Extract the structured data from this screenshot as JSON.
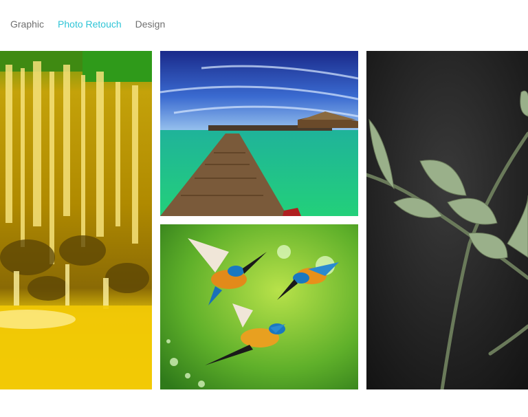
{
  "filter_tabs": [
    {
      "label": "Graphic",
      "active": false
    },
    {
      "label": "Photo Retouch",
      "active": true
    },
    {
      "label": "Design",
      "active": false
    }
  ],
  "accent_color": "#2ec4d6",
  "tab_text_color": "#6f6f6f",
  "portfolio": [
    {
      "subject": "golden waterfall"
    },
    {
      "subject": "tropical pier over turquoise water"
    },
    {
      "subject": "kingfishers in flight"
    },
    {
      "subject": "green leaves on dark background"
    }
  ]
}
